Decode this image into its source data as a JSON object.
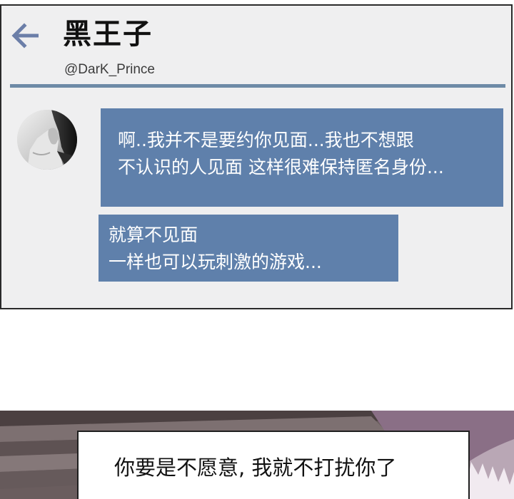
{
  "chat": {
    "contact_name": "黑王子",
    "contact_handle": "@DarK_Prince",
    "back_icon": "arrow-left-icon",
    "avatar_icon": "avatar-photo",
    "messages": [
      {
        "lines": [
          "啊..我并不是要约你见面...我也不想跟",
          "不认识的人见面 这样很难保持匿名身份..."
        ]
      },
      {
        "lines": [
          "就算不见面",
          "一样也可以玩刺激的游戏..."
        ]
      }
    ]
  },
  "caption": {
    "text": "你要是不愿意, 我就不打扰你了"
  },
  "colors": {
    "bubble": "#5f80ab",
    "divider": "#6d8aa6",
    "panel_background": "#efeff0",
    "back_arrow": "#6b7ea8"
  }
}
